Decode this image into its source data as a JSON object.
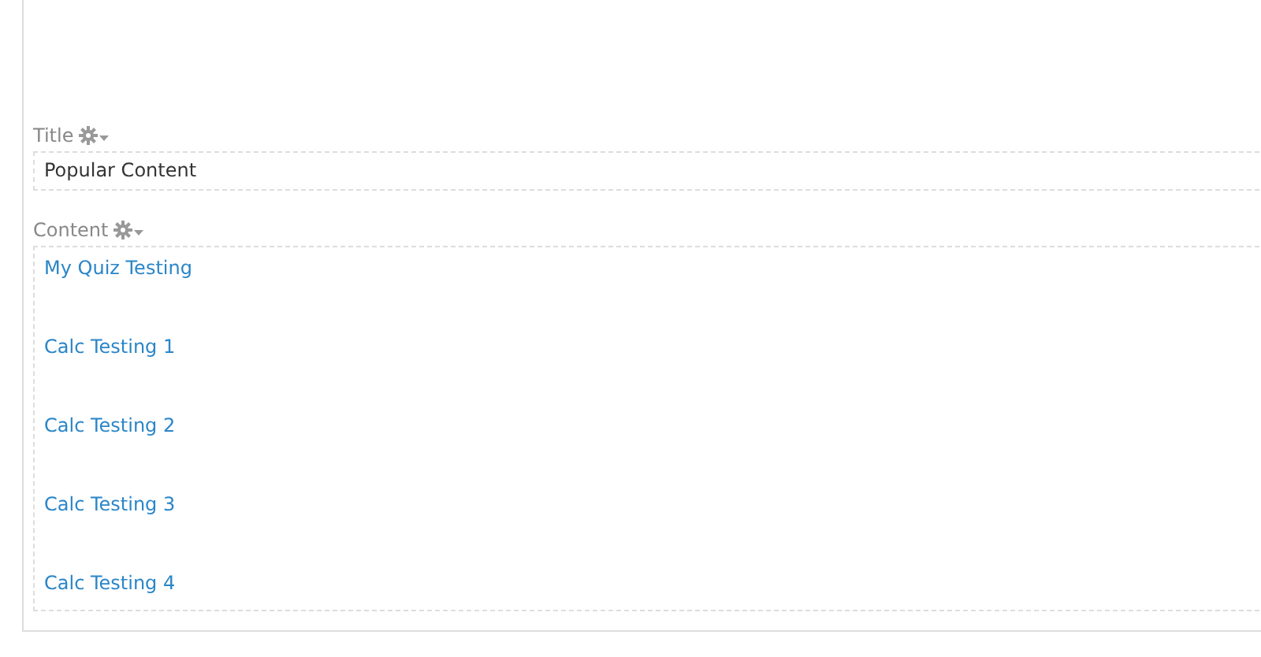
{
  "fields": [
    {
      "label": "Title",
      "kind": "text",
      "value": "Popular Content"
    },
    {
      "label": "Content",
      "kind": "links",
      "links": [
        "My Quiz Testing",
        "Calc Testing 1",
        "Calc Testing 2",
        "Calc Testing 3",
        "Calc Testing 4"
      ]
    }
  ]
}
